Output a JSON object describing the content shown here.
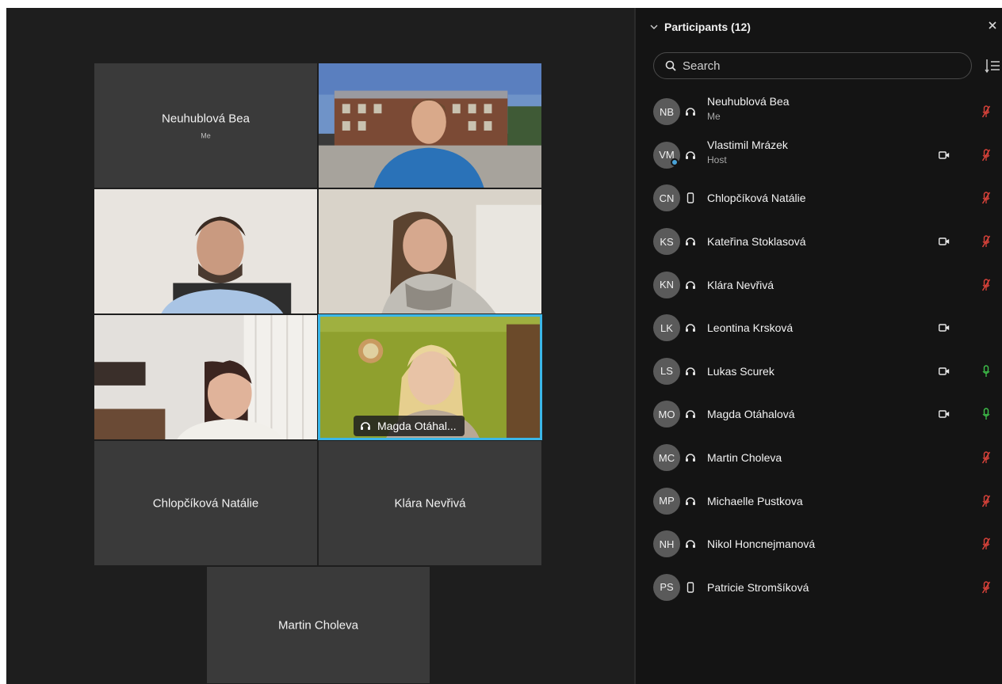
{
  "stage": {
    "tiles": [
      {
        "name": "Neuhublová Bea",
        "sub": "Me"
      },
      {
        "name": "Chlopčíková Natálie"
      },
      {
        "name": "Klára Nevřivá"
      },
      {
        "name": "Martin Choleva"
      }
    ],
    "active_speaker_label": "Magda Otáhal..."
  },
  "panel": {
    "title": "Participants (12)",
    "search_placeholder": "Search",
    "participants": [
      {
        "initials": "NB",
        "name": "Neuhublová Bea",
        "role": "Me",
        "conn": "headset",
        "camera": false,
        "mic": "muted"
      },
      {
        "initials": "VM",
        "name": "Vlastimil Mrázek",
        "role": "Host",
        "conn": "headset",
        "camera": true,
        "mic": "muted"
      },
      {
        "initials": "CN",
        "name": "Chlopčíková Natálie",
        "role": "",
        "conn": "phone",
        "camera": false,
        "mic": "muted"
      },
      {
        "initials": "KS",
        "name": "Kateřina  Stoklasová",
        "role": "",
        "conn": "headset",
        "camera": true,
        "mic": "muted"
      },
      {
        "initials": "KN",
        "name": "Klára Nevřivá",
        "role": "",
        "conn": "headset",
        "camera": false,
        "mic": "muted"
      },
      {
        "initials": "LK",
        "name": "Leontina Krsková",
        "role": "",
        "conn": "headset",
        "camera": true,
        "mic": "none"
      },
      {
        "initials": "LS",
        "name": "Lukas Scurek",
        "role": "",
        "conn": "headset",
        "camera": true,
        "mic": "on"
      },
      {
        "initials": "MO",
        "name": "Magda Otáhalová",
        "role": "",
        "conn": "headset",
        "camera": true,
        "mic": "on"
      },
      {
        "initials": "MC",
        "name": "Martin Choleva",
        "role": "",
        "conn": "headset",
        "camera": false,
        "mic": "muted"
      },
      {
        "initials": "MP",
        "name": "Michaelle Pustkova",
        "role": "",
        "conn": "headset",
        "camera": false,
        "mic": "muted"
      },
      {
        "initials": "NH",
        "name": "Nikol Honcnejmanová",
        "role": "",
        "conn": "headset",
        "camera": false,
        "mic": "muted"
      },
      {
        "initials": "PS",
        "name": "Patricie Stromšíková",
        "role": "",
        "conn": "phone",
        "camera": false,
        "mic": "muted"
      }
    ]
  },
  "colors": {
    "muted": "#d9423a",
    "mic_on": "#3ec24a",
    "active_border": "#3bb7e8"
  }
}
